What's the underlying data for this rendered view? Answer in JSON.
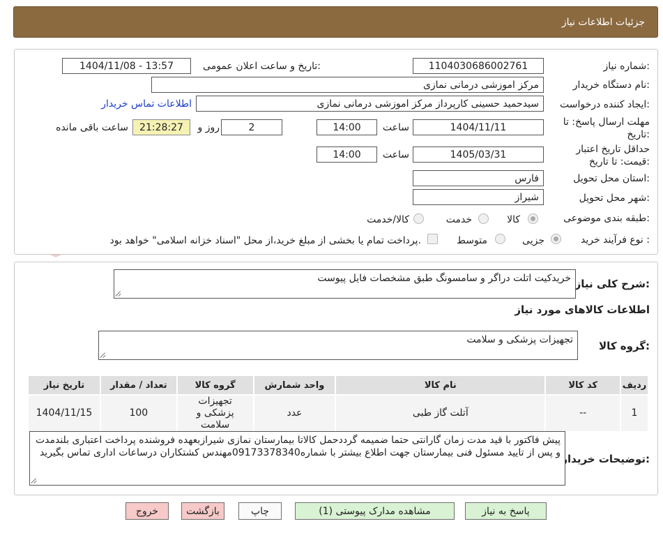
{
  "header": {
    "title": "جزئیات اطلاعات نیاز"
  },
  "form": {
    "need_number_label": "شماره نیاز:",
    "need_number": "1104030686002761",
    "announce_label": "تاریخ و ساعت اعلان عمومی:",
    "announce_value": "1404/11/08 - 13:57",
    "buyer_org_label": "نام دستگاه خریدار:",
    "buyer_org": "مرکز اموزشی درمانی نمازی",
    "requester_label": "ایجاد کننده درخواست:",
    "requester": "سیدحمید حسینی کارپرداز مرکز اموزشی درمانی نمازی",
    "contact_link": "اطلاعات تماس خریدار",
    "deadline_label": "مهلت ارسال پاسخ: تا تاریخ:",
    "deadline_date": "1404/11/11",
    "time_label": "ساعت",
    "deadline_time": "14:00",
    "days_value": "2",
    "days_label": "روز و",
    "remaining_time": "21:28:27",
    "remaining_label": "ساعت باقی مانده",
    "validity_label": "حداقل تاریخ اعتبار قیمت: تا تاریخ:",
    "validity_date": "1405/03/31",
    "validity_time": "14:00",
    "province_label": "استان محل تحویل:",
    "province": "فارس",
    "city_label": "شهر محل تحویل:",
    "city": "شیراز",
    "category_label": "طبقه بندی موضوعی:",
    "category_options": [
      "کالا",
      "خدمت",
      "کالا/خدمت"
    ],
    "process_label": "نوع فرآیند خرید :",
    "process_options": [
      "جزیی",
      "متوسط"
    ],
    "process_note": "پرداخت تمام یا بخشی از مبلغ خرید،از محل \"اسناد خزانه اسلامی\" خواهد بود."
  },
  "summary": {
    "label": "شرح کلی نیاز:",
    "text": "خریدکیت اتلت دراگر و سامسونگ طبق مشخصات فایل پیوست",
    "goods_heading": "اطلاعات کالاهای مورد نیاز",
    "group_label": "گروه کالا:",
    "group_value": "تجهیزات پزشکی و سلامت"
  },
  "table": {
    "headers": [
      "ردیف",
      "کد کالا",
      "نام کالا",
      "واحد شمارش",
      "گروه کالا",
      "تعداد / مقدار",
      "تاریخ نیاز"
    ],
    "rows": [
      [
        "1",
        "--",
        "آتلت گاز طبی",
        "عدد",
        "تجهیزات پزشکی و سلامت",
        "100",
        "1404/11/15"
      ]
    ]
  },
  "buyer_notes": {
    "label": "توضیحات خریدار:",
    "text": "پیش فاکتور با قید مدت زمان  گارانتی حتما ضمیمه گرددحمل کالاتا بیمارستان نمازی شیرازبعهده فروشنده پرداخت اعتباری بلندمدت و پس از تایید مسئول فنی بیمارستان جهت اطلاع بیشتر با شماره09173378340مهندس کشتکاران  درساعات اداری تماس بگیرید"
  },
  "buttons": {
    "reply": "پاسخ به نیاز",
    "attachments": "مشاهده مدارک پیوستی (1)",
    "print": "چاپ",
    "back": "بازگشت",
    "exit": "خروج"
  },
  "watermark": {
    "text": "AriaTender.neT"
  },
  "colors": {
    "header_bg": "#8b6a40",
    "link": "#1a3fcf",
    "timer_bg": "#f6f2b4",
    "btn_green": "#d9f2d4",
    "btn_red": "#f7c9c9"
  }
}
